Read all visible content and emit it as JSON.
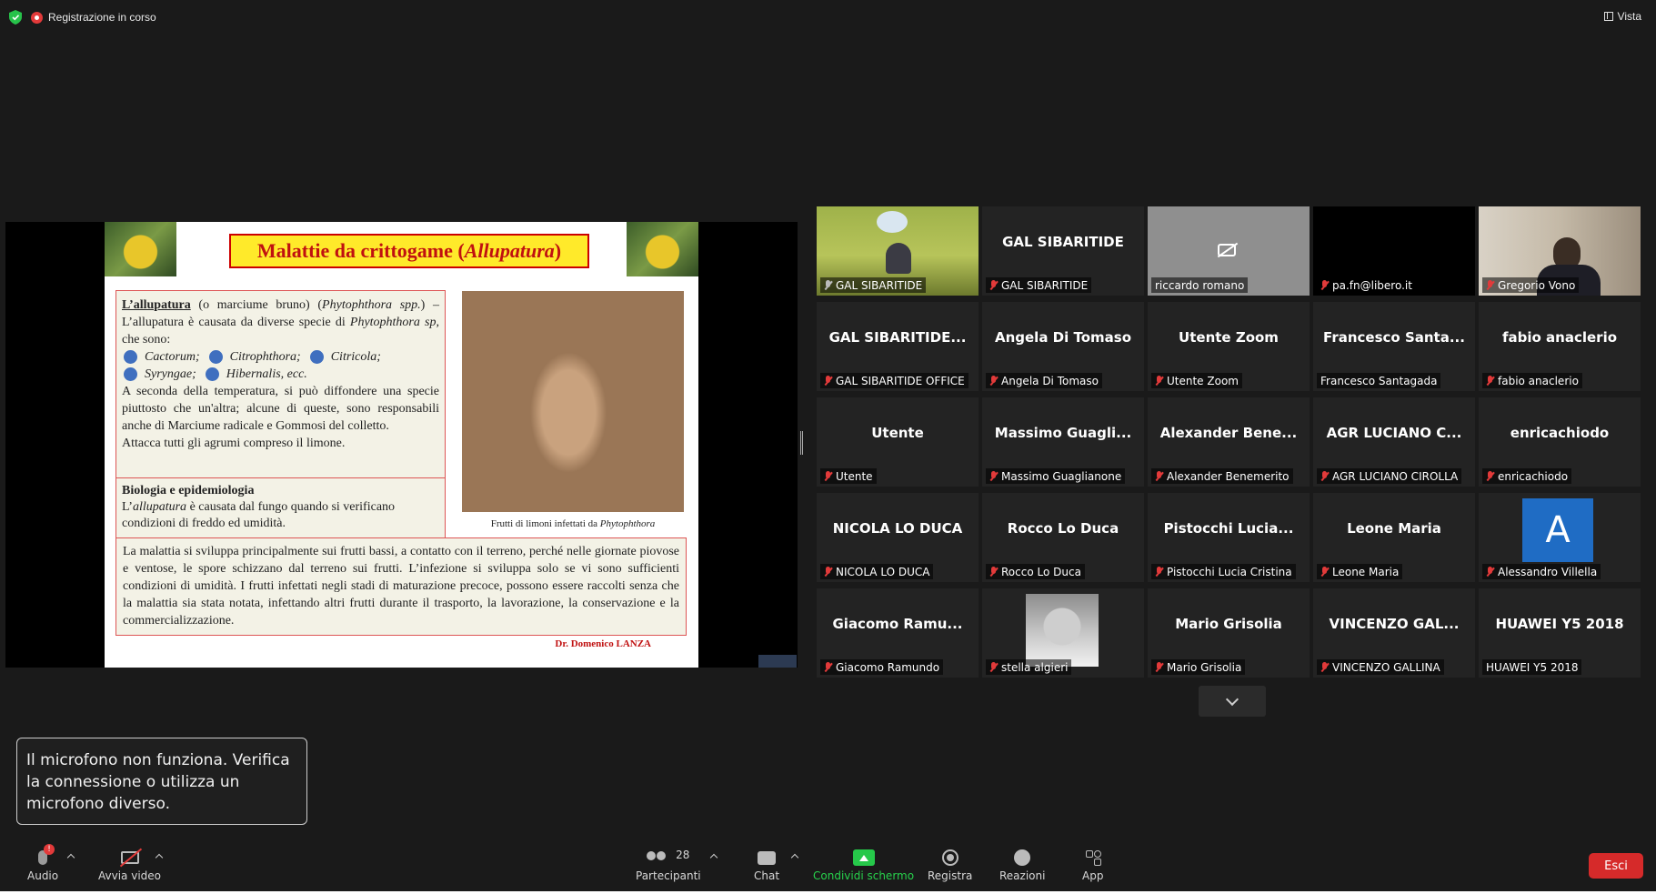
{
  "top": {
    "recording": "Registrazione in corso",
    "view": "Vista"
  },
  "slide": {
    "title_main": "Malattie da crittogame (",
    "title_italic": "Allupatura",
    "title_end": ")",
    "heading1": "L’allupatura",
    "p1a": " (o marciume bruno) (",
    "p1b": "Phytophthora spp.",
    "p1c": ") – L’allupatura è causata da diverse specie di ",
    "p1d": "Phytophthora sp,",
    "p1e": " che sono:",
    "species": [
      "Cactorum;",
      "Citrophthora;",
      "Citricola;",
      "Syryngae;",
      "Hibernalis, ecc."
    ],
    "p2": "A seconda della temperatura, si può diffondere una specie piuttosto che un'altra; alcune di queste, sono responsabili anche di Marciume radicale e Gommosi del colletto.",
    "p3": "Attacca tutti gli agrumi compreso il limone.",
    "heading2": "Biologia e epidemiologia",
    "p4a": "L’",
    "p4b": "allupatura",
    "p4c": " è causata dal fungo quando si verificano condizioni di freddo ed umidità.",
    "caption_a": "Frutti di limoni infettati da ",
    "caption_b": "Phytophthora",
    "p5": "La malattia si sviluppa principalmente sui frutti bassi, a contatto con il terreno, perché nelle giornate piovose e ventose, le spore schizzano dal terreno sui frutti. L’infezione si sviluppa solo se vi sono sufficienti condizioni di umidità. I frutti infettati negli stadi di maturazione precoce, possono essere raccolti senza che la malattia sia stata notata, infettando altri frutti durante il trasporto, la lavorazione, la conservazione e la commercializzazione.",
    "author": "Dr. Domenico LANZA"
  },
  "participants": [
    {
      "big": "",
      "name": "GAL SIBARITIDE",
      "kind": "video1",
      "mic": "on"
    },
    {
      "big": "GAL SIBARITIDE",
      "name": "GAL SIBARITIDE",
      "kind": "text",
      "mic": "off"
    },
    {
      "big": "",
      "name": "riccardo romano",
      "kind": "camoff",
      "mic": "none"
    },
    {
      "big": "",
      "name": "pa.fn@libero.it",
      "kind": "black",
      "mic": "off"
    },
    {
      "big": "",
      "name": "Gregorio Vono",
      "kind": "video2",
      "mic": "off"
    },
    {
      "big": "GAL SIBARITIDE...",
      "name": "GAL SIBARITIDE OFFICE",
      "kind": "text",
      "mic": "off"
    },
    {
      "big": "Angela Di Tomaso",
      "name": "Angela Di Tomaso",
      "kind": "text",
      "mic": "off"
    },
    {
      "big": "Utente Zoom",
      "name": "Utente Zoom",
      "kind": "text",
      "mic": "off"
    },
    {
      "big": "Francesco  Santa...",
      "name": "Francesco Santagada",
      "kind": "text",
      "mic": "none"
    },
    {
      "big": "fabio anaclerio",
      "name": "fabio anaclerio",
      "kind": "text",
      "mic": "off"
    },
    {
      "big": "Utente",
      "name": "Utente",
      "kind": "text",
      "mic": "off"
    },
    {
      "big": "Massimo  Guagli...",
      "name": "Massimo Guaglianone",
      "kind": "text",
      "mic": "off"
    },
    {
      "big": "Alexander  Bene...",
      "name": "Alexander Benemerito",
      "kind": "text",
      "mic": "off"
    },
    {
      "big": "AGR LUCIANO C...",
      "name": "AGR LUCIANO CIROLLA",
      "kind": "text",
      "mic": "off"
    },
    {
      "big": "enricachiodo",
      "name": "enricachiodo",
      "kind": "text",
      "mic": "off"
    },
    {
      "big": "NICOLA LO DUCA",
      "name": "NICOLA LO DUCA",
      "kind": "text",
      "mic": "off"
    },
    {
      "big": "Rocco Lo Duca",
      "name": "Rocco Lo Duca",
      "kind": "text",
      "mic": "off"
    },
    {
      "big": "Pistocchi  Lucia...",
      "name": "Pistocchi Lucia Cristina",
      "kind": "text",
      "mic": "off"
    },
    {
      "big": "Leone Maria",
      "name": "Leone Maria",
      "kind": "text",
      "mic": "off"
    },
    {
      "big": "A",
      "name": "Alessandro Villella",
      "kind": "avatar",
      "mic": "off"
    },
    {
      "big": "Giacomo  Ramu...",
      "name": "Giacomo Ramundo",
      "kind": "text",
      "mic": "off"
    },
    {
      "big": "",
      "name": "stella algieri",
      "kind": "photo",
      "mic": "off"
    },
    {
      "big": "Mario Grisolia",
      "name": "Mario Grisolia",
      "kind": "text",
      "mic": "off"
    },
    {
      "big": "VINCENZO GAL...",
      "name": "VINCENZO GALLINA",
      "kind": "text",
      "mic": "off"
    },
    {
      "big": "HUAWEI Y5 2018",
      "name": "HUAWEI Y5 2018",
      "kind": "text",
      "mic": "none"
    }
  ],
  "toast": "Il microfono non funziona. Verifica la connessione o utilizza un microfono diverso.",
  "toolbar": {
    "audio": "Audio",
    "audio_badge": "!",
    "video": "Avvia video",
    "participants": "Partecipanti",
    "participants_count": "28",
    "chat": "Chat",
    "share": "Condividi schermo",
    "record": "Registra",
    "reactions": "Reazioni",
    "apps": "App",
    "leave": "Esci"
  },
  "colors": {
    "share_green": "#27d24c",
    "leave_red": "#d62a2a",
    "active_speaker": "#ffe338"
  }
}
